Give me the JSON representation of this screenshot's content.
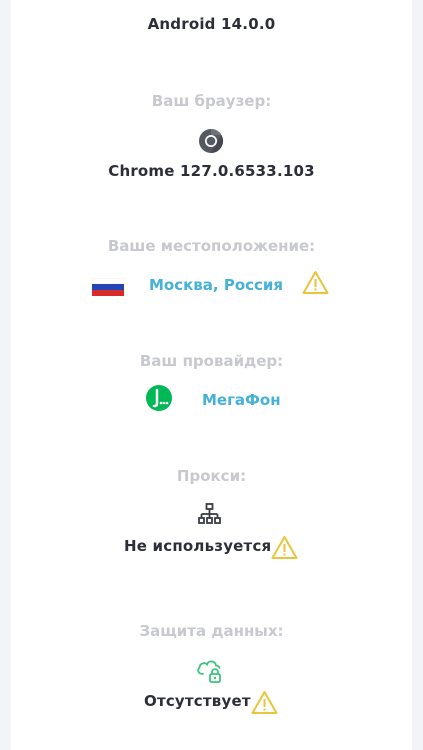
{
  "os": {
    "value": "Android 14.0.0"
  },
  "browser": {
    "label": "Ваш браузер:",
    "icon": "chrome-icon",
    "value": "Chrome 127.0.6533.103"
  },
  "location": {
    "label": "Ваше местоположение:",
    "flag": "russia-flag-icon",
    "value": "Москва, Россия",
    "warning_icon": "warning-icon"
  },
  "provider": {
    "label": "Ваш провайдер:",
    "icon": "megafon-logo-icon",
    "value": "МегаФон"
  },
  "proxy": {
    "label": "Прокси:",
    "icon": "network-icon",
    "value": "Не используется",
    "warning_icon": "warning-icon"
  },
  "data_protection": {
    "label": "Защита данных:",
    "icon": "cloud-lock-icon",
    "value": "Отсутствует",
    "warning_icon": "warning-icon"
  },
  "colors": {
    "label_gray": "#c8c9ce",
    "value_dark": "#2d2f38",
    "link_blue": "#46b1d8",
    "warning_yellow": "#e8c53a",
    "megafon_green": "#00b956",
    "cloud_green": "#3cc47c"
  }
}
